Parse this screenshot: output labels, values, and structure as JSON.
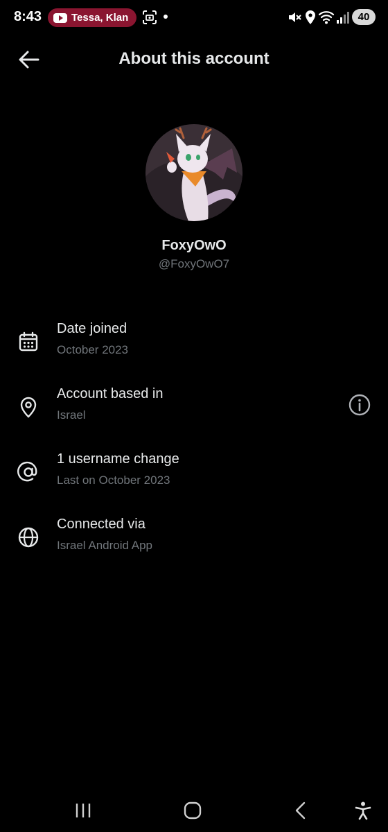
{
  "status_bar": {
    "time": "8:43",
    "notification_text": "Tessa, Klan",
    "battery": "40",
    "icons": [
      "youtube-icon",
      "screenshot-icon",
      "mute-icon",
      "location-icon",
      "wifi-icon",
      "signal-icon",
      "battery-icon"
    ]
  },
  "header": {
    "title": "About this account",
    "back_icon": "arrow-left-icon"
  },
  "profile": {
    "display_name": "FoxyOwO",
    "handle": "@FoxyOwO7"
  },
  "rows": [
    {
      "icon": "calendar-icon",
      "title": "Date joined",
      "subtitle": "October 2023"
    },
    {
      "icon": "location-pin-icon",
      "title": "Account based in",
      "subtitle": "Israel",
      "trailing_icon": "info-icon"
    },
    {
      "icon": "at-sign-icon",
      "title": "1 username change",
      "subtitle": "Last on October 2023"
    },
    {
      "icon": "globe-icon",
      "title": "Connected via",
      "subtitle": "Israel Android App"
    }
  ],
  "nav_bar": {
    "icons": [
      "recents-icon",
      "home-icon",
      "back-icon",
      "accessibility-icon"
    ]
  },
  "colors": {
    "background": "#000000",
    "primary_text": "#e7e9ea",
    "secondary_text": "#71767b",
    "notification_pill": "#8a1530"
  }
}
